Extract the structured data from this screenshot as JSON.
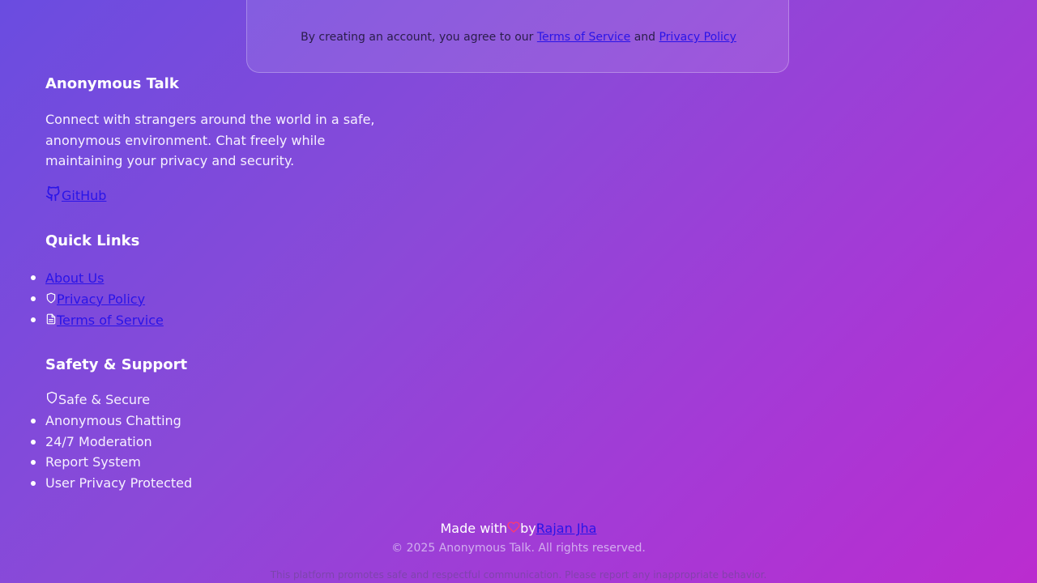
{
  "card": {
    "terms_prefix": "By creating an account, you agree to our",
    "terms_link": "Terms of Service",
    "and": "and",
    "privacy_link": "Privacy Policy"
  },
  "brand": {
    "title": "Anonymous Talk",
    "description": "Connect with strangers around the world in a safe, anonymous environment. Chat freely while maintaining your privacy and security.",
    "github_label": "GitHub",
    "github_icon": "github-icon"
  },
  "quick_links": {
    "title": "Quick Links",
    "items": [
      {
        "label": "About Us",
        "icon": ""
      },
      {
        "label": "Privacy Policy",
        "icon": "shield-icon"
      },
      {
        "label": "Terms of Service",
        "icon": "document-icon"
      }
    ]
  },
  "safety": {
    "title": "Safety & Support",
    "header_item": "Safe & Secure",
    "header_icon": "shield-icon",
    "items": [
      "Anonymous Chatting",
      "24/7 Moderation",
      "Report System",
      "User Privacy Protected"
    ]
  },
  "footer": {
    "made_with": "Made with",
    "by": "by",
    "author": "Rajan Jha",
    "heart_icon": "heart-icon",
    "copyright": "© 2025 Anonymous Talk. All rights reserved.",
    "notice": "This platform promotes safe and respectful communication. Please report any inappropriate behavior."
  },
  "colors": {
    "link": "#2a14e8",
    "heart": "#ff3a6e",
    "gradient_start": "#6a4ce0",
    "gradient_end": "#bb2ccf"
  }
}
